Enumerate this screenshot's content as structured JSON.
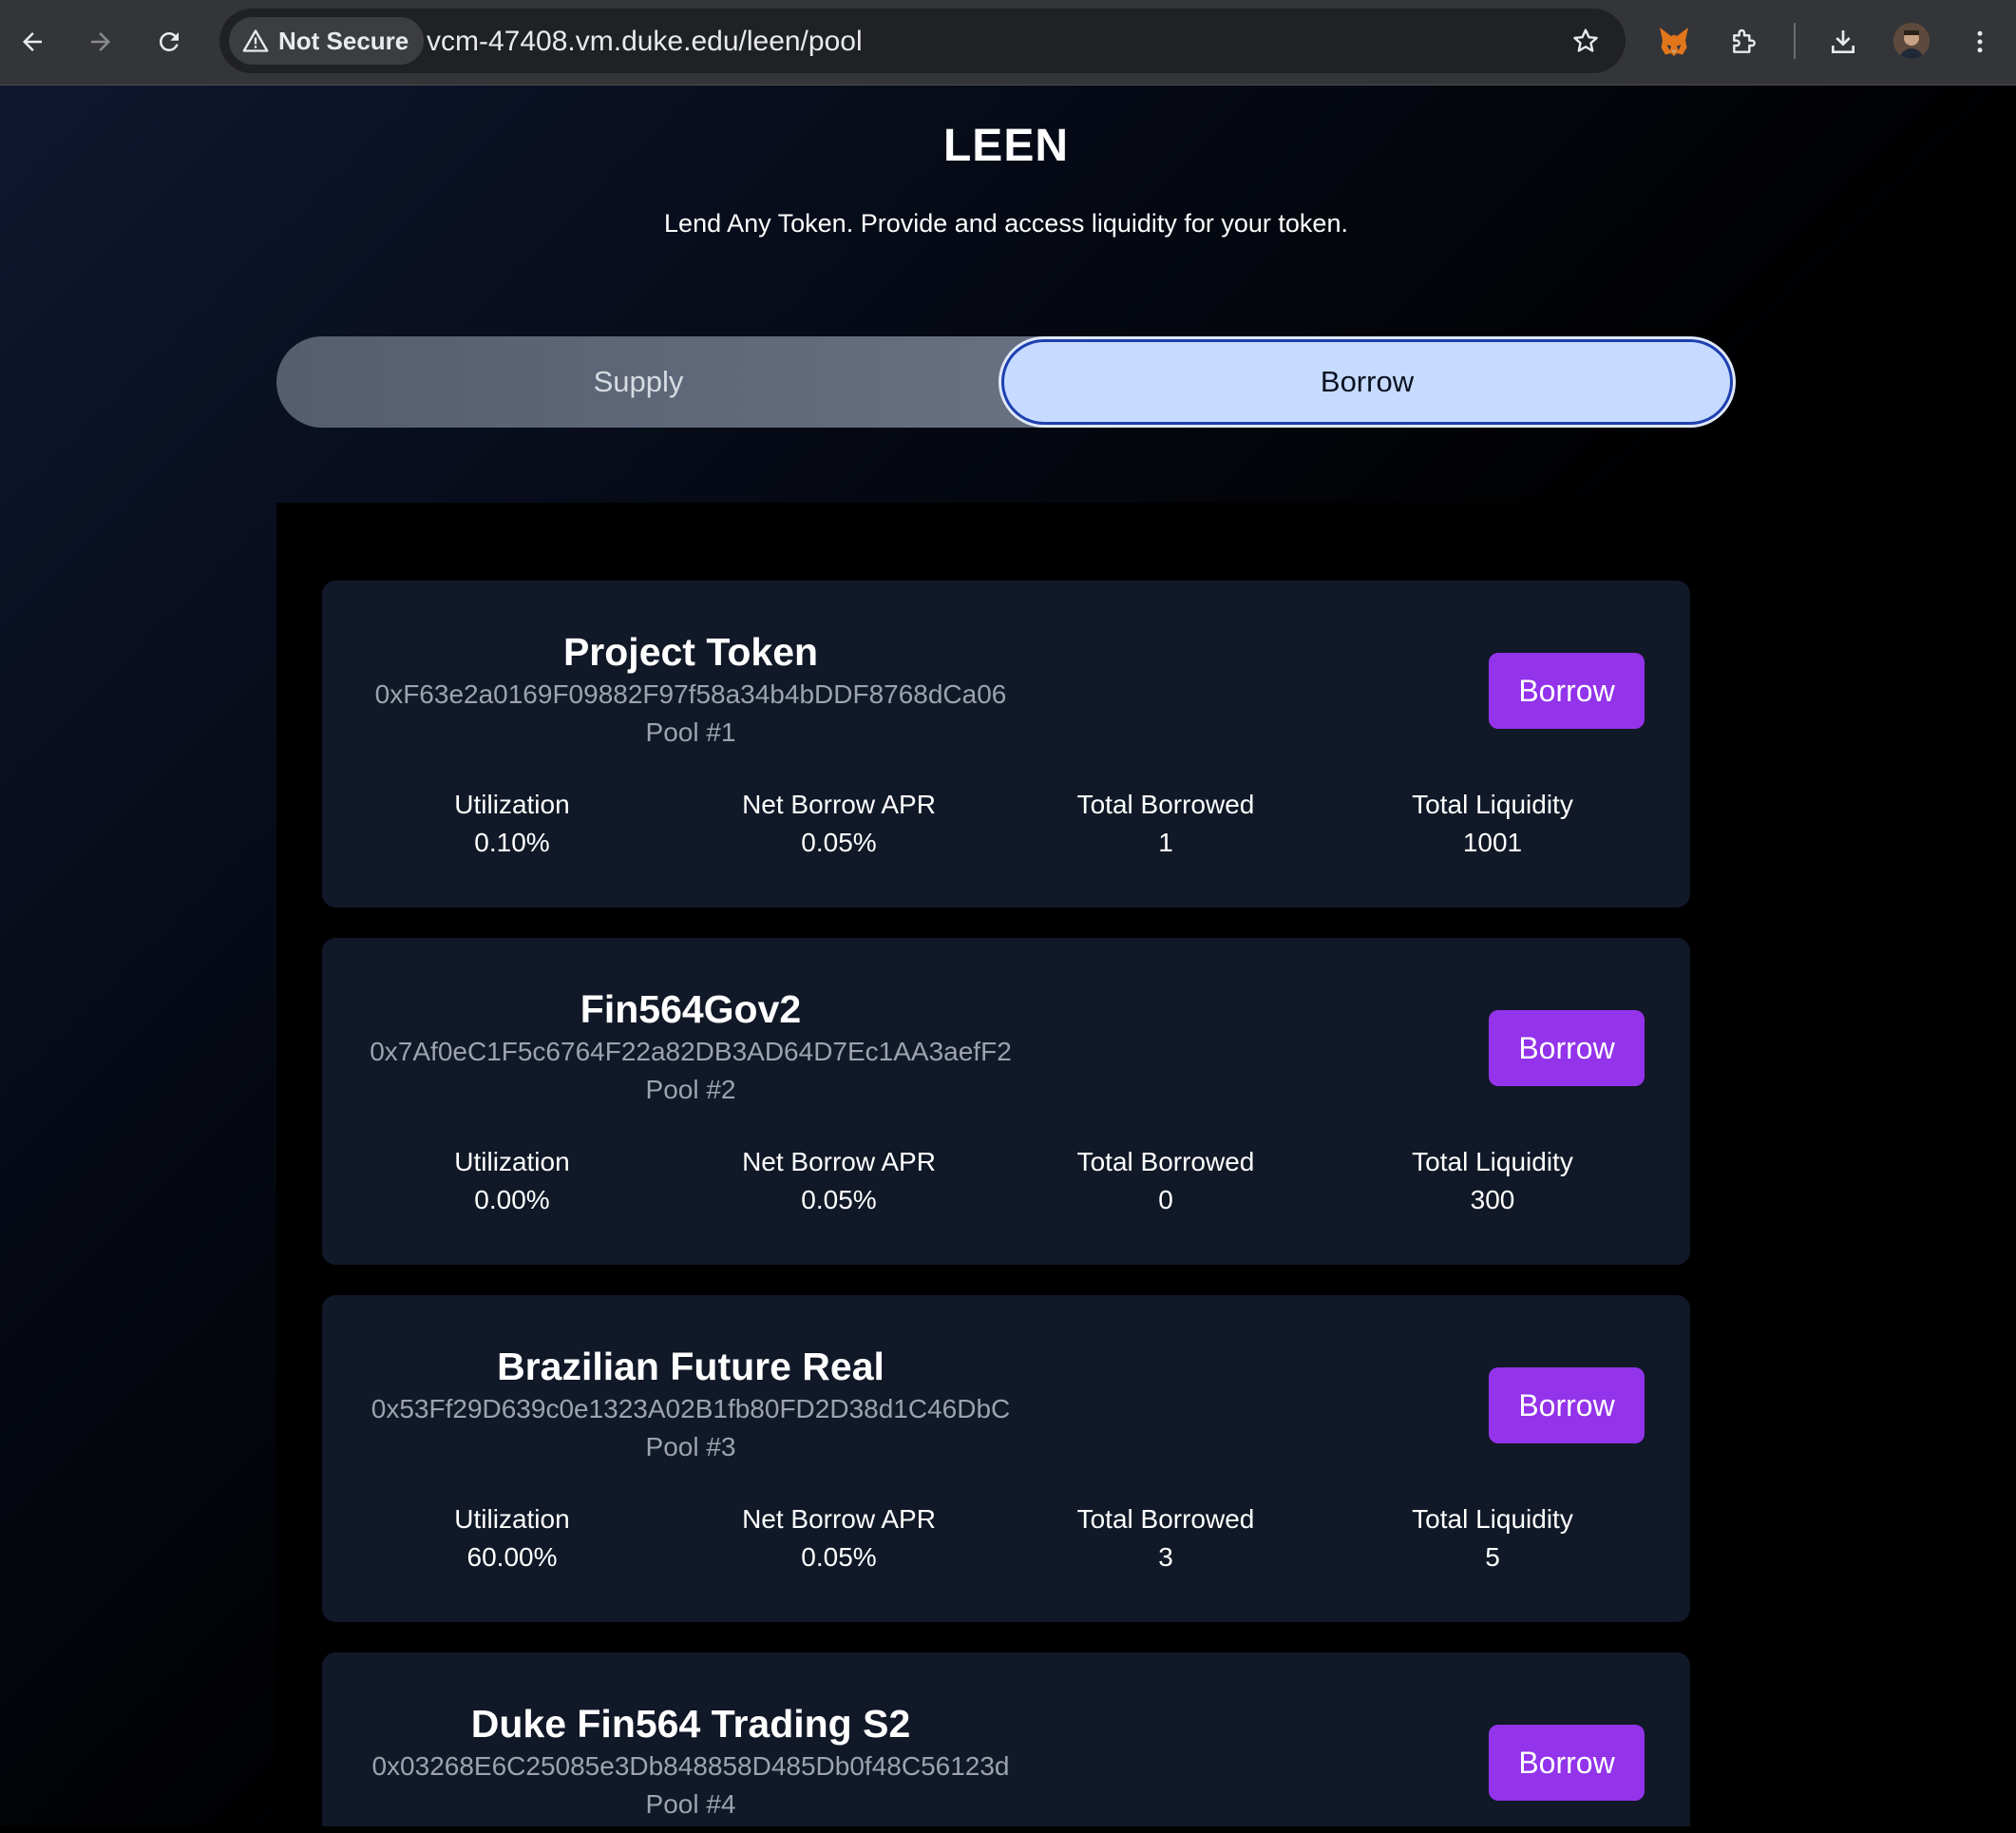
{
  "browser": {
    "security_label": "Not Secure",
    "url": "vcm-47408.vm.duke.edu/leen/pool"
  },
  "header": {
    "title": "LEEN",
    "subtitle": "Lend Any Token. Provide and access liquidity for your token."
  },
  "tabs": {
    "supply": "Supply",
    "borrow": "Borrow",
    "active": "Borrow"
  },
  "colors": {
    "accent": "#9333ea",
    "card": "#111827",
    "active_tab": "#c6dbff"
  },
  "stat_labels": {
    "utilization": "Utilization",
    "apr": "Net Borrow APR",
    "borrowed": "Total Borrowed",
    "liquidity": "Total Liquidity"
  },
  "pools": [
    {
      "name": "Project Token",
      "address": "0xF63e2a0169F09882F97f58a34b4bDDF8768dCa06",
      "pool_label": "Pool #1",
      "button": "Borrow",
      "utilization": "0.10%",
      "apr": "0.05%",
      "borrowed": "1",
      "liquidity": "1001"
    },
    {
      "name": "Fin564Gov2",
      "address": "0x7Af0eC1F5c6764F22a82DB3AD64D7Ec1AA3aefF2",
      "pool_label": "Pool #2",
      "button": "Borrow",
      "utilization": "0.00%",
      "apr": "0.05%",
      "borrowed": "0",
      "liquidity": "300"
    },
    {
      "name": "Brazilian Future Real",
      "address": "0x53Ff29D639c0e1323A02B1fb80FD2D38d1C46DbC",
      "pool_label": "Pool #3",
      "button": "Borrow",
      "utilization": "60.00%",
      "apr": "0.05%",
      "borrowed": "3",
      "liquidity": "5"
    },
    {
      "name": "Duke Fin564 Trading S2",
      "address": "0x03268E6C25085e3Db848858D485Db0f48C56123d",
      "pool_label": "Pool #4",
      "button": "Borrow"
    }
  ]
}
